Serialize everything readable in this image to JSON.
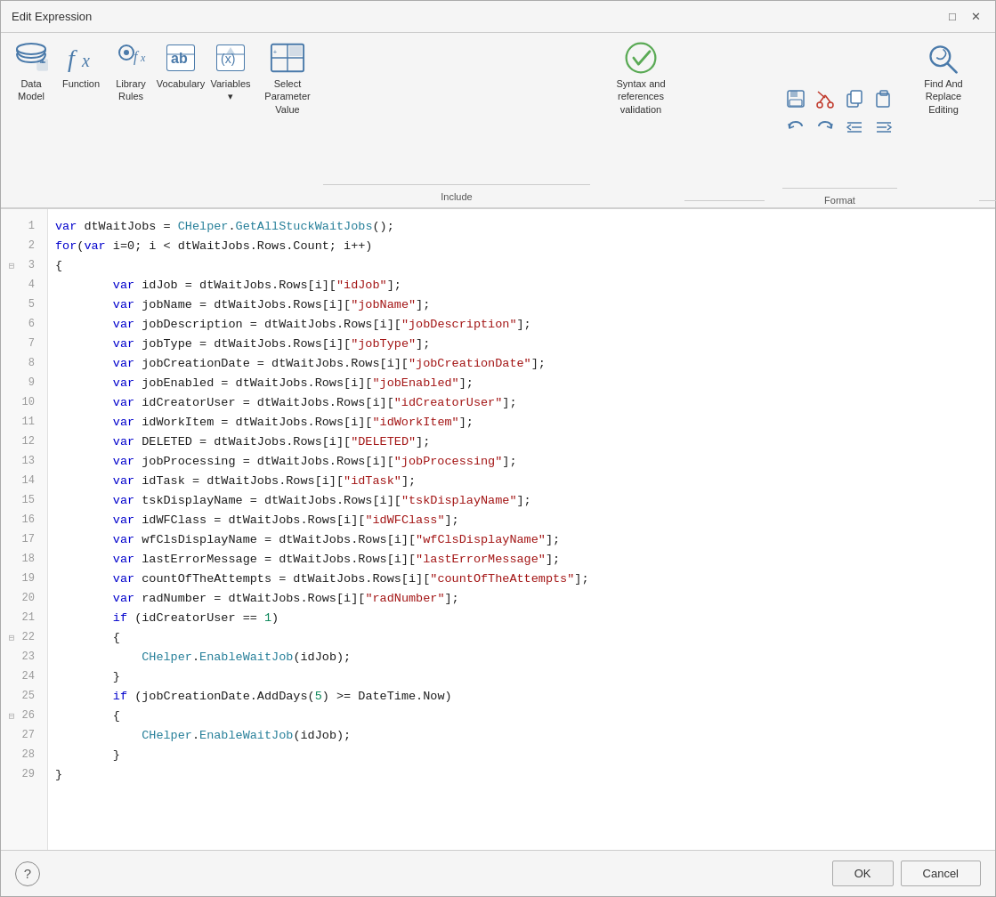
{
  "dialog": {
    "title": "Edit Expression"
  },
  "toolbar": {
    "items": [
      {
        "id": "data-model",
        "label": "Data\nModel",
        "icon": "🗄"
      },
      {
        "id": "function",
        "label": "Function",
        "icon": "𝑓𝓍"
      },
      {
        "id": "library-rules",
        "label": "Library\nRules",
        "icon": "👤𝑓"
      },
      {
        "id": "vocabulary",
        "label": "Vocabulary",
        "icon": "ab"
      },
      {
        "id": "variables",
        "label": "Variables",
        "icon": "(x)"
      },
      {
        "id": "select-param",
        "label": "Select Parameter\nValue",
        "icon": "⊞"
      }
    ],
    "include_label": "Include",
    "syntax_label": "Syntax and references\nvalidation",
    "format_label": "Format",
    "find_replace_label": "Find And\nReplace\nEditing"
  },
  "code": {
    "lines": [
      {
        "num": 1,
        "fold": "",
        "tokens": [
          {
            "t": "kw",
            "v": "var "
          },
          {
            "t": "id",
            "v": "dtWaitJobs = "
          },
          {
            "t": "cls",
            "v": "CHelper"
          },
          {
            "t": "id",
            "v": "."
          },
          {
            "t": "method",
            "v": "GetAllStuckWaitJobs"
          },
          {
            "t": "id",
            "v": "();"
          }
        ]
      },
      {
        "num": 2,
        "fold": "",
        "tokens": [
          {
            "t": "kw",
            "v": "for"
          },
          {
            "t": "id",
            "v": "("
          },
          {
            "t": "kw",
            "v": "var "
          },
          {
            "t": "id",
            "v": "i=0; i < dtWaitJobs.Rows.Count; i++)"
          }
        ]
      },
      {
        "num": 3,
        "fold": "⊟",
        "tokens": [
          {
            "t": "id",
            "v": "{"
          }
        ]
      },
      {
        "num": 4,
        "fold": "",
        "tokens": [
          {
            "t": "id",
            "v": "        "
          },
          {
            "t": "kw",
            "v": "var "
          },
          {
            "t": "id",
            "v": "idJob = dtWaitJobs.Rows[i]["
          },
          {
            "t": "str",
            "v": "\"idJob\""
          },
          {
            "t": "id",
            "v": "];"
          }
        ]
      },
      {
        "num": 5,
        "fold": "",
        "tokens": [
          {
            "t": "id",
            "v": "        "
          },
          {
            "t": "kw",
            "v": "var "
          },
          {
            "t": "id",
            "v": "jobName = dtWaitJobs.Rows[i]["
          },
          {
            "t": "str",
            "v": "\"jobName\""
          },
          {
            "t": "id",
            "v": "];"
          }
        ]
      },
      {
        "num": 6,
        "fold": "",
        "tokens": [
          {
            "t": "id",
            "v": "        "
          },
          {
            "t": "kw",
            "v": "var "
          },
          {
            "t": "id",
            "v": "jobDescription = dtWaitJobs.Rows[i]["
          },
          {
            "t": "str",
            "v": "\"jobDescription\""
          },
          {
            "t": "id",
            "v": "];"
          }
        ]
      },
      {
        "num": 7,
        "fold": "",
        "tokens": [
          {
            "t": "id",
            "v": "        "
          },
          {
            "t": "kw",
            "v": "var "
          },
          {
            "t": "id",
            "v": "jobType = dtWaitJobs.Rows[i]["
          },
          {
            "t": "str",
            "v": "\"jobType\""
          },
          {
            "t": "id",
            "v": "];"
          }
        ]
      },
      {
        "num": 8,
        "fold": "",
        "tokens": [
          {
            "t": "id",
            "v": "        "
          },
          {
            "t": "kw",
            "v": "var "
          },
          {
            "t": "id",
            "v": "jobCreationDate = dtWaitJobs.Rows[i]["
          },
          {
            "t": "str",
            "v": "\"jobCreationDate\""
          },
          {
            "t": "id",
            "v": "];"
          }
        ]
      },
      {
        "num": 9,
        "fold": "",
        "tokens": [
          {
            "t": "id",
            "v": "        "
          },
          {
            "t": "kw",
            "v": "var "
          },
          {
            "t": "id",
            "v": "jobEnabled = dtWaitJobs.Rows[i]["
          },
          {
            "t": "str",
            "v": "\"jobEnabled\""
          },
          {
            "t": "id",
            "v": "];"
          }
        ]
      },
      {
        "num": 10,
        "fold": "",
        "tokens": [
          {
            "t": "id",
            "v": "        "
          },
          {
            "t": "kw",
            "v": "var "
          },
          {
            "t": "id",
            "v": "idCreatorUser = dtWaitJobs.Rows[i]["
          },
          {
            "t": "str",
            "v": "\"idCreatorUser\""
          },
          {
            "t": "id",
            "v": "];"
          }
        ]
      },
      {
        "num": 11,
        "fold": "",
        "tokens": [
          {
            "t": "id",
            "v": "        "
          },
          {
            "t": "kw",
            "v": "var "
          },
          {
            "t": "id",
            "v": "idWorkItem = dtWaitJobs.Rows[i]["
          },
          {
            "t": "str",
            "v": "\"idWorkItem\""
          },
          {
            "t": "id",
            "v": "];"
          }
        ]
      },
      {
        "num": 12,
        "fold": "",
        "tokens": [
          {
            "t": "id",
            "v": "        "
          },
          {
            "t": "kw",
            "v": "var "
          },
          {
            "t": "id",
            "v": "DELETED = dtWaitJobs.Rows[i]["
          },
          {
            "t": "str",
            "v": "\"DELETED\""
          },
          {
            "t": "id",
            "v": "];"
          }
        ]
      },
      {
        "num": 13,
        "fold": "",
        "tokens": [
          {
            "t": "id",
            "v": "        "
          },
          {
            "t": "kw",
            "v": "var "
          },
          {
            "t": "id",
            "v": "jobProcessing = dtWaitJobs.Rows[i]["
          },
          {
            "t": "str",
            "v": "\"jobProcessing\""
          },
          {
            "t": "id",
            "v": "];"
          }
        ]
      },
      {
        "num": 14,
        "fold": "",
        "tokens": [
          {
            "t": "id",
            "v": "        "
          },
          {
            "t": "kw",
            "v": "var "
          },
          {
            "t": "id",
            "v": "idTask = dtWaitJobs.Rows[i]["
          },
          {
            "t": "str",
            "v": "\"idTask\""
          },
          {
            "t": "id",
            "v": "];"
          }
        ]
      },
      {
        "num": 15,
        "fold": "",
        "tokens": [
          {
            "t": "id",
            "v": "        "
          },
          {
            "t": "kw",
            "v": "var "
          },
          {
            "t": "id",
            "v": "tskDisplayName = dtWaitJobs.Rows[i]["
          },
          {
            "t": "str",
            "v": "\"tskDisplayName\""
          },
          {
            "t": "id",
            "v": "];"
          }
        ]
      },
      {
        "num": 16,
        "fold": "",
        "tokens": [
          {
            "t": "id",
            "v": "        "
          },
          {
            "t": "kw",
            "v": "var "
          },
          {
            "t": "id",
            "v": "idWFClass = dtWaitJobs.Rows[i]["
          },
          {
            "t": "str",
            "v": "\"idWFClass\""
          },
          {
            "t": "id",
            "v": "];"
          }
        ]
      },
      {
        "num": 17,
        "fold": "",
        "tokens": [
          {
            "t": "id",
            "v": "        "
          },
          {
            "t": "kw",
            "v": "var "
          },
          {
            "t": "id",
            "v": "wfClsDisplayName = dtWaitJobs.Rows[i]["
          },
          {
            "t": "str",
            "v": "\"wfClsDisplayName\""
          },
          {
            "t": "id",
            "v": "];"
          }
        ]
      },
      {
        "num": 18,
        "fold": "",
        "tokens": [
          {
            "t": "id",
            "v": "        "
          },
          {
            "t": "kw",
            "v": "var "
          },
          {
            "t": "id",
            "v": "lastErrorMessage = dtWaitJobs.Rows[i]["
          },
          {
            "t": "str",
            "v": "\"lastErrorMessage\""
          },
          {
            "t": "id",
            "v": "];"
          }
        ]
      },
      {
        "num": 19,
        "fold": "",
        "tokens": [
          {
            "t": "id",
            "v": "        "
          },
          {
            "t": "kw",
            "v": "var "
          },
          {
            "t": "id",
            "v": "countOfTheAttempts = dtWaitJobs.Rows[i]["
          },
          {
            "t": "str",
            "v": "\"countOfTheAttempts\""
          },
          {
            "t": "id",
            "v": "];"
          }
        ]
      },
      {
        "num": 20,
        "fold": "",
        "tokens": [
          {
            "t": "id",
            "v": "        "
          },
          {
            "t": "kw",
            "v": "var "
          },
          {
            "t": "id",
            "v": "radNumber = dtWaitJobs.Rows[i]["
          },
          {
            "t": "str",
            "v": "\"radNumber\""
          },
          {
            "t": "id",
            "v": "];"
          }
        ]
      },
      {
        "num": 21,
        "fold": "",
        "tokens": [
          {
            "t": "id",
            "v": "        "
          },
          {
            "t": "kw",
            "v": "if "
          },
          {
            "t": "id",
            "v": "(idCreatorUser == "
          },
          {
            "t": "num",
            "v": "1"
          },
          {
            "t": "id",
            "v": ")"
          }
        ]
      },
      {
        "num": 22,
        "fold": "⊟",
        "tokens": [
          {
            "t": "id",
            "v": "        {"
          }
        ]
      },
      {
        "num": 23,
        "fold": "",
        "tokens": [
          {
            "t": "id",
            "v": "            "
          },
          {
            "t": "cls",
            "v": "CHelper"
          },
          {
            "t": "id",
            "v": "."
          },
          {
            "t": "method",
            "v": "EnableWaitJob"
          },
          {
            "t": "id",
            "v": "(idJob);"
          }
        ]
      },
      {
        "num": 24,
        "fold": "",
        "tokens": [
          {
            "t": "id",
            "v": "        }"
          }
        ]
      },
      {
        "num": 25,
        "fold": "",
        "tokens": [
          {
            "t": "id",
            "v": "        "
          },
          {
            "t": "kw",
            "v": "if "
          },
          {
            "t": "id",
            "v": "(jobCreationDate.AddDays("
          },
          {
            "t": "num",
            "v": "5"
          },
          {
            "t": "id",
            "v": ") >= DateTime.Now)"
          }
        ]
      },
      {
        "num": 26,
        "fold": "⊟",
        "tokens": [
          {
            "t": "id",
            "v": "        {"
          }
        ]
      },
      {
        "num": 27,
        "fold": "",
        "tokens": [
          {
            "t": "id",
            "v": "            "
          },
          {
            "t": "cls",
            "v": "CHelper"
          },
          {
            "t": "id",
            "v": "."
          },
          {
            "t": "method",
            "v": "EnableWaitJob"
          },
          {
            "t": "id",
            "v": "(idJob);"
          }
        ]
      },
      {
        "num": 28,
        "fold": "",
        "tokens": [
          {
            "t": "id",
            "v": "        }"
          }
        ]
      },
      {
        "num": 29,
        "fold": "",
        "tokens": [
          {
            "t": "id",
            "v": "}"
          }
        ]
      }
    ]
  },
  "footer": {
    "help_icon": "?",
    "ok_label": "OK",
    "cancel_label": "Cancel"
  }
}
